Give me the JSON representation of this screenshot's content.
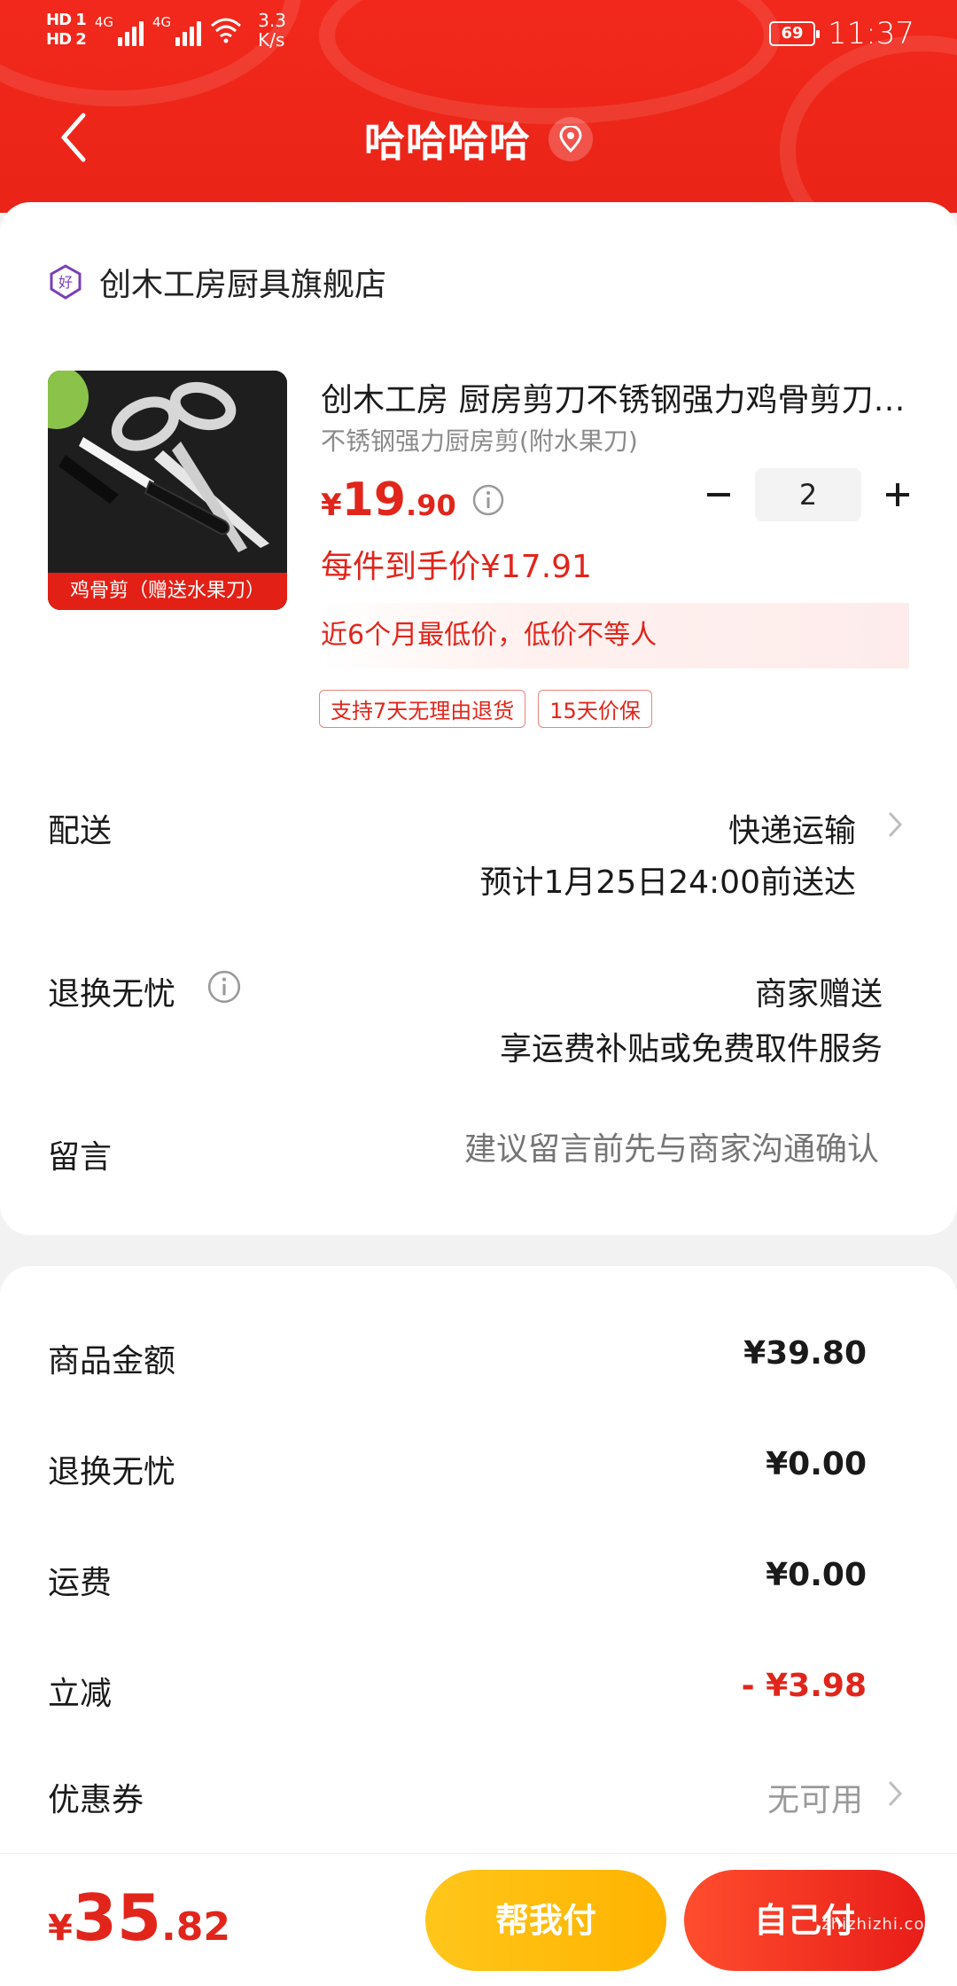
{
  "status_bar": {
    "hd1": "HD 1",
    "hd2": "HD 2",
    "net1": "4G",
    "net2": "4G",
    "speed_value": "3.3",
    "speed_unit": "K/s",
    "battery": "69",
    "time": "11:37"
  },
  "header": {
    "title": "哈哈哈哈",
    "back_icon": "chevron-left-icon",
    "location_icon": "location-pin-icon"
  },
  "shop": {
    "name": "创木工房厨具旗舰店",
    "icon": "good-shop-badge-icon"
  },
  "product": {
    "title": "创木工房 厨房剪刀不锈钢强力鸡骨剪刀家用多功能",
    "spec": "不锈钢强力厨房剪(附水果刀)",
    "image_caption": "鸡骨剪（赠送水果刀）",
    "price_symbol": "¥",
    "price_int": "19",
    "price_dec": ".90",
    "final_price": "每件到手价¥17.91",
    "lowest_note": "近6个月最低价，低价不等人",
    "tags": [
      "支持7天无理由退货",
      "15天价保"
    ],
    "quantity": "2"
  },
  "delivery": {
    "label": "配送",
    "method": "快递运输",
    "eta": "预计1月25日24:00前送达"
  },
  "return_service": {
    "label": "退换无忧",
    "gift": "商家赠送",
    "desc": "享运费补贴或免费取件服务"
  },
  "message": {
    "label": "留言",
    "placeholder": "建议留言前先与商家沟通确认"
  },
  "summary": {
    "goods_label": "商品金额",
    "goods_value": "¥39.80",
    "return_label": "退换无忧",
    "return_value": "¥0.00",
    "shipping_label": "运费",
    "shipping_value": "¥0.00",
    "discount_label": "立减",
    "discount_value": "- ¥3.98",
    "coupon_label": "优惠券",
    "coupon_value": "无可用"
  },
  "bottom": {
    "total_symbol": "¥",
    "total_int": "35",
    "total_dec": ".82",
    "help_pay": "帮我付",
    "self_pay": "自己付"
  },
  "watermark": "zhizhizhi.com",
  "colors": {
    "brand_red": "#e1251b",
    "header_red": "#f2281c",
    "help_yellow": "#ffb300"
  }
}
